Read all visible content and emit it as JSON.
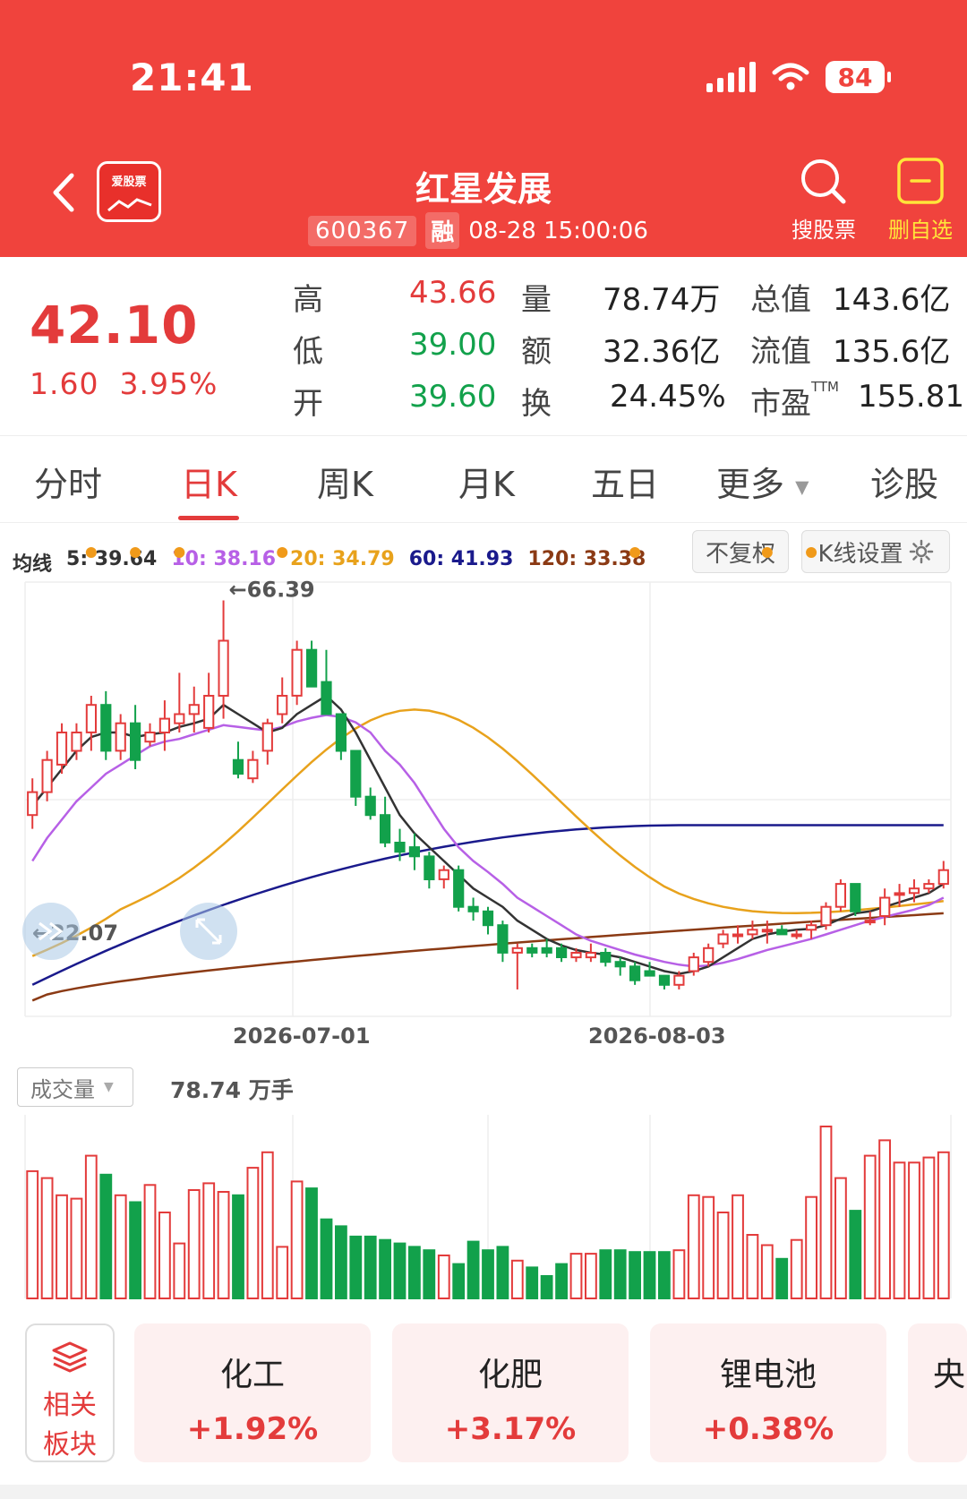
{
  "status": {
    "time": "21:41",
    "battery": "84"
  },
  "header": {
    "app_logo_text": "爱股票",
    "stock_name": "红星发展",
    "code": "600367",
    "margin_badge": "融",
    "datetime": "08-28 15:00:06",
    "search_label": "搜股票",
    "remove_watch_label": "删自选"
  },
  "quote": {
    "price": "42.10",
    "change": "1.60",
    "change_pct": "3.95%",
    "high_label": "高",
    "high": "43.66",
    "low_label": "低",
    "low": "39.00",
    "open_label": "开",
    "open": "39.60",
    "volume_label": "量",
    "volume": "78.74万",
    "amount_label": "额",
    "amount": "32.36亿",
    "turnover_label": "换",
    "turnover": "24.45%",
    "mktcap_label": "总值",
    "mktcap": "143.6亿",
    "float_label": "流值",
    "float_cap": "135.6亿",
    "pe_label": "市盈",
    "pe_sup": "TTM",
    "pe": "155.81"
  },
  "tabs": [
    "分时",
    "日K",
    "周K",
    "月K",
    "五日",
    "更多",
    "诊股"
  ],
  "active_tab": "日K",
  "ma_legend": {
    "title": "均线",
    "items": [
      {
        "label": "5: 39.64",
        "color": "#333333"
      },
      {
        "label": "10: 38.16",
        "color": "#b760e6"
      },
      {
        "label": "20: 34.79",
        "color": "#e8a21c"
      },
      {
        "label": "60: 41.93",
        "color": "#1a1a8c"
      },
      {
        "label": "120: 33.38",
        "color": "#8b3a14"
      }
    ]
  },
  "chart_buttons": {
    "adjust": "不复权",
    "settings": "K线设置"
  },
  "chart_annotations": {
    "high_label": "←66.39",
    "low_label": "←22.07"
  },
  "x_axis": {
    "dates": [
      "2026-07-01",
      "2026-08-03"
    ]
  },
  "volume_section": {
    "selector": "成交量",
    "value": "78.74 万手"
  },
  "related": {
    "label_line1": "相关",
    "label_line2": "板块",
    "sectors": [
      {
        "name": "化工",
        "pct": "+1.92%"
      },
      {
        "name": "化肥",
        "pct": "+3.17%"
      },
      {
        "name": "锂电池",
        "pct": "+0.38%"
      },
      {
        "name": "央",
        "pct": ""
      }
    ]
  },
  "colors": {
    "up": "#e33b3b",
    "down": "#12a14b",
    "header": "#f0433d"
  },
  "chart_data": {
    "type": "candlestick",
    "series_order": [
      "open",
      "high",
      "low",
      "close"
    ],
    "y_range": [
      22.07,
      66.39
    ],
    "candles": [
      [
        43,
        47,
        41.5,
        45.5
      ],
      [
        45.5,
        50,
        44.5,
        49
      ],
      [
        48.5,
        53,
        47.5,
        52
      ],
      [
        50,
        53,
        49,
        52
      ],
      [
        52,
        56,
        50,
        55
      ],
      [
        55,
        56.5,
        49,
        50
      ],
      [
        50,
        54,
        49,
        53
      ],
      [
        53,
        55,
        48,
        49
      ],
      [
        51,
        53,
        50.5,
        52
      ],
      [
        52,
        55.5,
        50,
        53.5
      ],
      [
        53,
        58.5,
        52,
        54
      ],
      [
        54,
        57,
        52,
        55
      ],
      [
        52.5,
        58.5,
        52,
        56
      ],
      [
        56,
        66.39,
        53.5,
        62
      ],
      [
        49,
        51,
        47,
        47.5
      ],
      [
        47,
        50,
        46.5,
        49
      ],
      [
        50,
        53.5,
        48.5,
        53
      ],
      [
        54,
        58,
        53,
        56
      ],
      [
        56,
        62,
        55,
        61
      ],
      [
        61,
        62,
        58,
        57
      ],
      [
        57.5,
        61,
        55,
        54
      ],
      [
        54,
        54,
        49,
        50
      ],
      [
        50,
        50,
        44,
        45
      ],
      [
        45,
        46,
        42.5,
        43
      ],
      [
        43,
        45,
        39.5,
        40
      ],
      [
        40,
        41.5,
        38,
        39
      ],
      [
        39.5,
        41,
        37,
        38.5
      ],
      [
        38.5,
        39,
        35,
        36
      ],
      [
        36,
        37.5,
        35,
        37
      ],
      [
        37,
        37.5,
        32.5,
        33
      ],
      [
        33,
        34,
        31.5,
        32.5
      ],
      [
        32.5,
        33,
        30,
        31
      ],
      [
        31,
        31.5,
        27,
        28
      ],
      [
        28,
        29,
        24,
        28.5
      ],
      [
        28.5,
        29,
        27.5,
        28
      ],
      [
        28.5,
        29.5,
        27.5,
        28
      ],
      [
        28.5,
        29,
        27,
        27.5
      ],
      [
        27.5,
        28.5,
        27,
        28
      ],
      [
        27.5,
        29,
        27,
        28
      ],
      [
        28,
        28.5,
        26.5,
        27
      ],
      [
        27,
        27.5,
        25.5,
        26.5
      ],
      [
        26.5,
        27,
        24.5,
        25
      ],
      [
        26,
        27,
        25.5,
        25.5
      ],
      [
        25.5,
        25.5,
        24,
        24.5
      ],
      [
        24.5,
        26,
        24,
        25.5
      ],
      [
        26,
        28,
        25.5,
        27.5
      ],
      [
        27,
        29,
        26.5,
        28.5
      ],
      [
        29,
        30.5,
        28.5,
        30
      ],
      [
        30,
        31,
        29,
        30
      ],
      [
        30,
        31.5,
        29.5,
        30.5
      ],
      [
        30.5,
        31.5,
        29,
        30.5
      ],
      [
        30.5,
        31,
        30,
        30
      ],
      [
        30,
        30.5,
        29.5,
        30
      ],
      [
        30.5,
        31.5,
        29.5,
        31
      ],
      [
        31,
        33.5,
        30.5,
        33
      ],
      [
        33,
        36,
        32.5,
        35.5
      ],
      [
        35.5,
        35.5,
        32,
        32.5
      ],
      [
        31.5,
        32.5,
        31,
        31.5
      ],
      [
        32,
        35,
        31,
        34
      ],
      [
        34.5,
        35.5,
        33,
        34.5
      ],
      [
        34.5,
        36,
        33.5,
        35
      ],
      [
        35,
        36,
        34.5,
        35.5
      ],
      [
        35.5,
        38,
        35,
        37
      ]
    ],
    "ma5": [
      44,
      46,
      48,
      50,
      51.5,
      52,
      52,
      51.5,
      51.8,
      52,
      52.6,
      53,
      53.5,
      55,
      54,
      53,
      52,
      52.5,
      54,
      55,
      56,
      54.5,
      52,
      49,
      46,
      43,
      41,
      39.5,
      38,
      36.5,
      35,
      34,
      33,
      31.5,
      30.5,
      29.5,
      28.8,
      28.3,
      28,
      27.8,
      27.5,
      27,
      26.5,
      26,
      25.7,
      26,
      26.5,
      27.5,
      28.5,
      29.5,
      30,
      30.3,
      30.5,
      30.6,
      31,
      31.7,
      32.3,
      32.5,
      33,
      33.5,
      34,
      34.5,
      35.5
    ],
    "ma10": [
      38,
      40.5,
      42.5,
      44.5,
      46,
      47.5,
      48.5,
      49.5,
      50.5,
      51,
      51.3,
      51.8,
      52.3,
      52.8,
      52.6,
      52.4,
      52.2,
      52.6,
      53.2,
      53.6,
      53.9,
      53.7,
      53.1,
      52,
      50,
      48.5,
      46.5,
      44,
      41.5,
      39.5,
      38,
      36.8,
      35.5,
      34,
      33,
      32,
      31,
      30,
      29.3,
      28.8,
      28.3,
      27.8,
      27.4,
      27,
      26.7,
      26.5,
      26.6,
      26.9,
      27.3,
      27.8,
      28.3,
      28.7,
      29.1,
      29.5,
      30,
      30.5,
      31,
      31.5,
      31.9,
      32.3,
      32.7,
      33.2,
      34
    ]
  }
}
